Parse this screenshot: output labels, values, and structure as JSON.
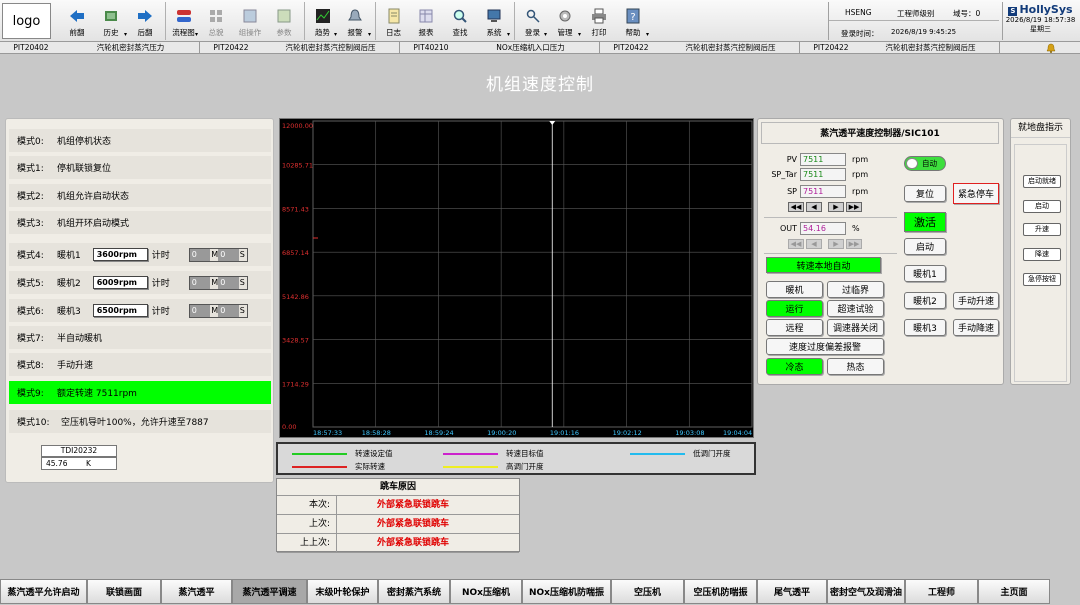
{
  "toolbar": {
    "logo": "logo",
    "tools": [
      {
        "label": "前翻",
        "icon": "arrow-left-icon",
        "dim": false,
        "dd": false
      },
      {
        "label": "历史",
        "icon": "history-icon",
        "dim": false,
        "dd": true
      },
      {
        "label": "后翻",
        "icon": "arrow-right-icon",
        "dim": false,
        "dd": false
      },
      {
        "label": "流程图",
        "icon": "flowchart-icon",
        "dim": false,
        "dd": true
      },
      {
        "label": "总貌",
        "icon": "overview-icon",
        "dim": true,
        "dd": false
      },
      {
        "label": "组操作",
        "icon": "group-icon",
        "dim": true,
        "dd": false
      },
      {
        "label": "参数",
        "icon": "parameter-icon",
        "dim": true,
        "dd": false
      },
      {
        "label": "趋势",
        "icon": "trend-icon",
        "dim": false,
        "dd": true
      },
      {
        "label": "报警",
        "icon": "alarm-icon",
        "dim": false,
        "dd": true
      },
      {
        "label": "日志",
        "icon": "log-icon",
        "dim": false,
        "dd": false
      },
      {
        "label": "报表",
        "icon": "report-icon",
        "dim": false,
        "dd": false
      },
      {
        "label": "查找",
        "icon": "search-icon",
        "dim": false,
        "dd": false
      },
      {
        "label": "系统",
        "icon": "system-icon",
        "dim": false,
        "dd": true
      },
      {
        "label": "登录",
        "icon": "key-icon",
        "dim": false,
        "dd": true
      },
      {
        "label": "管理",
        "icon": "gear-icon",
        "dim": false,
        "dd": true
      },
      {
        "label": "打印",
        "icon": "printer-icon",
        "dim": false,
        "dd": false
      },
      {
        "label": "帮助",
        "icon": "help-icon",
        "dim": false,
        "dd": true
      }
    ],
    "user": "HSENG",
    "role": "工程师级别",
    "domain_label": "域号：",
    "domain_value": "0",
    "login_label": "登录时间：",
    "login_time": "2026/8/19 9:45:25",
    "brand": "HollySys",
    "datetime": "2026/8/19 18:57:38",
    "weekday": "星期三"
  },
  "ticker": [
    {
      "tag": "PIT20402",
      "desc": "汽轮机密封蒸汽压力"
    },
    {
      "tag": "PIT20422",
      "desc": "汽轮机密封蒸汽控制阀后压"
    },
    {
      "tag": "PIT40210",
      "desc": "NOx压缩机入口压力"
    },
    {
      "tag": "PIT20422",
      "desc": "汽轮机密封蒸汽控制阀后压"
    },
    {
      "tag": "PIT20422",
      "desc": "汽轮机密封蒸汽控制阀后压"
    }
  ],
  "title": "机组速度控制",
  "modes": [
    {
      "id": "模式0:",
      "text": "机组停机状态"
    },
    {
      "id": "模式1:",
      "text": "停机联锁复位"
    },
    {
      "id": "模式2:",
      "text": "机组允许启动状态"
    },
    {
      "id": "模式3:",
      "text": "机组开环启动模式"
    },
    {
      "id": "模式4:",
      "text": "暖机1",
      "speed": "3600rpm",
      "timer_label": "计时",
      "timer": [
        "0",
        "0"
      ],
      "units": [
        "M",
        "S"
      ]
    },
    {
      "id": "模式5:",
      "text": "暖机2",
      "speed": "6009rpm",
      "timer_label": "计时",
      "timer": [
        "0",
        "0"
      ],
      "units": [
        "M",
        "S"
      ]
    },
    {
      "id": "模式6:",
      "text": "暖机3",
      "speed": "6500rpm",
      "timer_label": "计时",
      "timer": [
        "0",
        "0"
      ],
      "units": [
        "M",
        "S"
      ]
    },
    {
      "id": "模式7:",
      "text": "半自动暖机"
    },
    {
      "id": "模式8:",
      "text": "手动升速"
    },
    {
      "id": "模式9:",
      "text": "额定转速   7511rpm",
      "active": true
    },
    {
      "id": "模式10:",
      "text": "空压机导叶100%，允许升速至7887"
    }
  ],
  "tdi": {
    "tag": "TDI20232",
    "value": "45.76",
    "unit": "K"
  },
  "chart_data": {
    "type": "line",
    "y_ticks": [
      "12000.00",
      "10285.71",
      "8571.43",
      "6857.14",
      "5142.86",
      "3428.57",
      "1714.29",
      "0.00"
    ],
    "x_ticks": [
      "18:57:33",
      "18:58:28",
      "18:59:24",
      "19:00:20",
      "19:01:16",
      "19:02:12",
      "19:03:08",
      "19:04:04"
    ],
    "ylim": [
      0,
      12000
    ],
    "grid": true,
    "series": [
      {
        "name": "转速设定值",
        "color": "#22cc22"
      },
      {
        "name": "转速目标值",
        "color": "#cc22cc"
      },
      {
        "name": "低调门开度",
        "color": "#22bbee"
      },
      {
        "name": "实际转速",
        "color": "#dd2222"
      },
      {
        "name": "高调门开度",
        "color": "#eeee22"
      }
    ]
  },
  "trip": {
    "title": "跳车原因",
    "rows": [
      {
        "k": "本次:",
        "v": "外部紧急联锁跳车"
      },
      {
        "k": "上次:",
        "v": "外部紧急联锁跳车"
      },
      {
        "k": "上上次:",
        "v": "外部紧急联锁跳车"
      }
    ]
  },
  "controller": {
    "title": "蒸汽透平速度控制器/SIC101",
    "pv_label": "PV",
    "pv": "7511",
    "sptar_label": "SP_Tar",
    "sptar": "7511",
    "sp_label": "SP",
    "sp": "7511",
    "rpm": "rpm",
    "out_label": "OUT",
    "out": "54.16",
    "pct": "%",
    "auto": "自动",
    "local_auto": "转速本地自动",
    "buttons": {
      "reset": "复位",
      "estop": "紧急停车",
      "activate": "激活",
      "start": "启动",
      "warm1": "暖机1",
      "warm2": "暖机2",
      "warm3": "暖机3",
      "manual_up": "手动升速",
      "manual_down": "手动降速",
      "warm": "暖机",
      "overcrit": "过临界",
      "run": "运行",
      "overspeed": "超速试验",
      "remote": "远程",
      "gov_closed": "调速器关闭",
      "overspeed_alarm": "速度过度偏差报警",
      "cold": "冷态",
      "hot": "热态"
    }
  },
  "local": {
    "title": "就地盘指示",
    "items": [
      "启动就绪",
      "启动",
      "升速",
      "降速",
      "急停按钮"
    ]
  },
  "nav": [
    {
      "label": "蒸汽透平允许启动"
    },
    {
      "label": "联锁画面"
    },
    {
      "label": "蒸汽透平"
    },
    {
      "label": "蒸汽透平调速",
      "active": true
    },
    {
      "label": "末级叶轮保护"
    },
    {
      "label": "密封蒸汽系统"
    },
    {
      "label": "NOx压缩机"
    },
    {
      "label": "NOx压缩机防喘振"
    },
    {
      "label": "空压机"
    },
    {
      "label": "空压机防喘振"
    },
    {
      "label": "尾气透平"
    },
    {
      "label": "密封空气及润滑油"
    },
    {
      "label": "工程师"
    },
    {
      "label": "主页面"
    }
  ]
}
